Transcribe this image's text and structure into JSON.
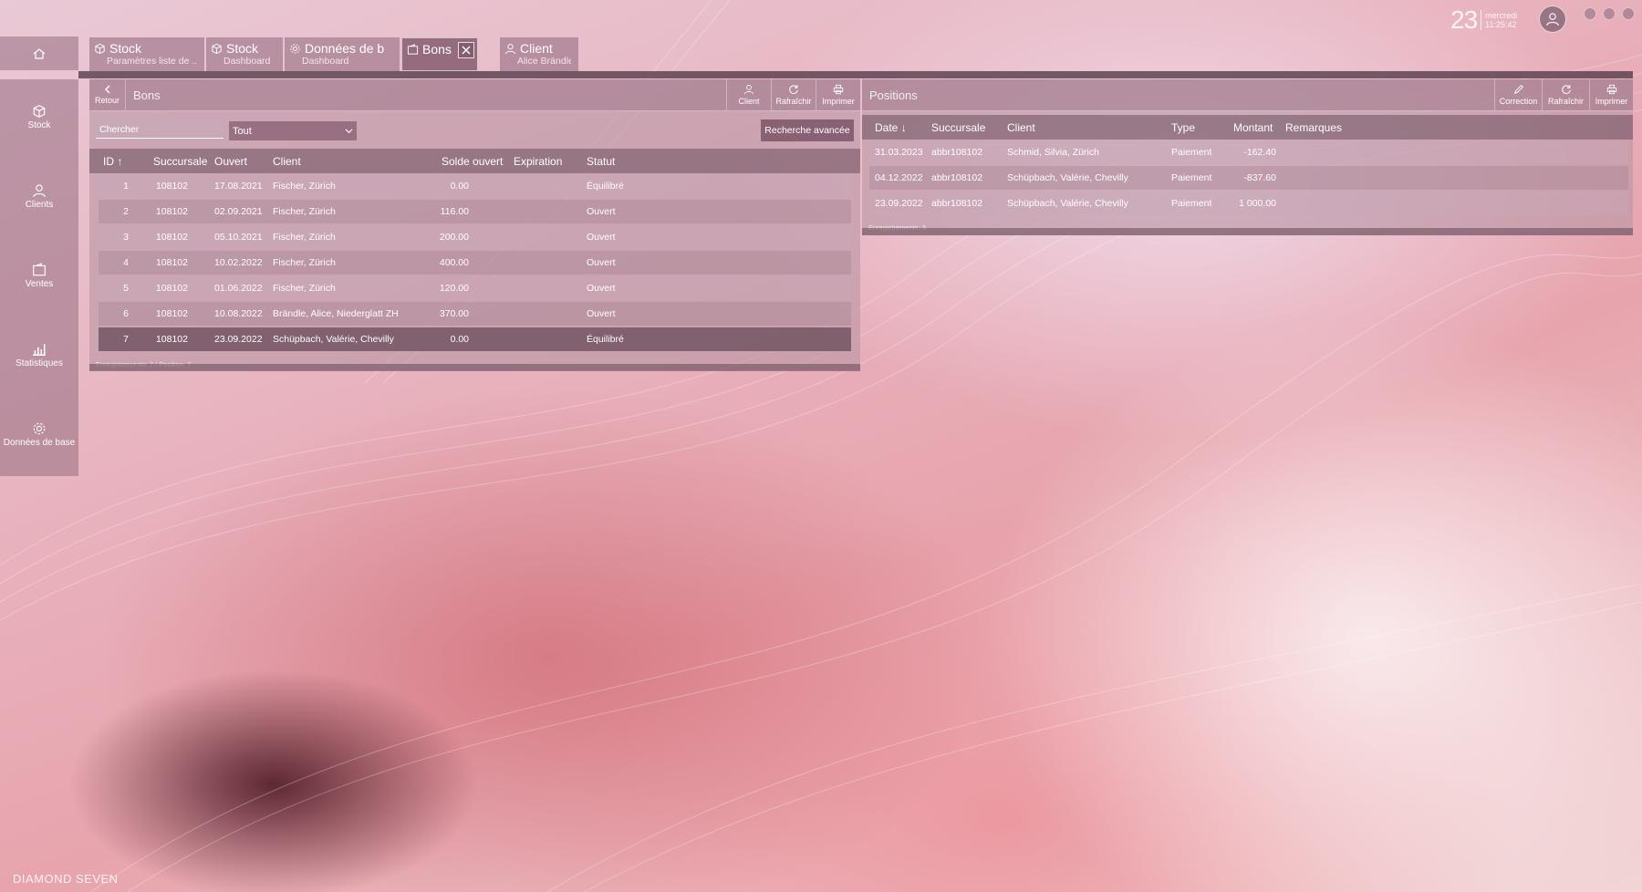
{
  "header": {
    "tabs": [
      {
        "icon": "box-icon",
        "title": "Stock",
        "subtitle": "Paramètres liste de ..."
      },
      {
        "icon": "box-icon",
        "title": "Stock",
        "subtitle": "Dashboard"
      },
      {
        "icon": "gear-icon",
        "title": "Données de b",
        "subtitle": "Dashboard"
      },
      {
        "icon": "wallet-icon",
        "title": "Bons",
        "subtitle": ""
      },
      {
        "icon": "user-icon",
        "title": "Client",
        "subtitle": "Alice Brändle"
      }
    ],
    "clock": {
      "day": "23",
      "weekday": "mercredi",
      "time": "11:25:42"
    }
  },
  "sidebar": {
    "items": [
      {
        "label": "Stock",
        "icon": "box-icon"
      },
      {
        "label": "Clients",
        "icon": "user-icon"
      },
      {
        "label": "Ventes",
        "icon": "wallet-icon"
      },
      {
        "label": "Statistiques",
        "icon": "bar-chart-icon"
      },
      {
        "label": "Données de base",
        "icon": "gear-icon"
      }
    ]
  },
  "left_panel": {
    "title": "Bons",
    "back_label": "Retour",
    "toolbar": {
      "client": "Client",
      "refresh": "Rafraîchir",
      "print": "Imprimer"
    },
    "search_placeholder": "Chercher",
    "filter_value": "Tout",
    "advanced_search": "Recherche avancée",
    "columns": {
      "id": "ID",
      "branch": "Succursale",
      "opened": "Ouvert",
      "client": "Client",
      "balance": "Solde ouvert",
      "expiration": "Expiration",
      "status": "Statut"
    },
    "rows": [
      {
        "id": "1",
        "branch": "108102",
        "opened": "17.08.2021",
        "client": "Fischer, Zürich",
        "balance": "0.00",
        "expiration": "",
        "status": "Équilibré"
      },
      {
        "id": "2",
        "branch": "108102",
        "opened": "02.09.2021",
        "client": "Fischer, Zürich",
        "balance": "116.00",
        "expiration": "",
        "status": "Ouvert"
      },
      {
        "id": "3",
        "branch": "108102",
        "opened": "05.10.2021",
        "client": "Fischer, Zürich",
        "balance": "200.00",
        "expiration": "",
        "status": "Ouvert"
      },
      {
        "id": "4",
        "branch": "108102",
        "opened": "10.02.2022",
        "client": "Fischer, Zürich",
        "balance": "400.00",
        "expiration": "",
        "status": "Ouvert"
      },
      {
        "id": "5",
        "branch": "108102",
        "opened": "01.06.2022",
        "client": "Fischer, Zürich",
        "balance": "120.00",
        "expiration": "",
        "status": "Ouvert"
      },
      {
        "id": "6",
        "branch": "108102",
        "opened": "10.08.2022",
        "client": "Brändle, Alice, Niederglatt ZH",
        "balance": "370.00",
        "expiration": "",
        "status": "Ouvert"
      },
      {
        "id": "7",
        "branch": "108102",
        "opened": "23.09.2022",
        "client": "Schüpbach, Valérie, Chevilly",
        "balance": "0.00",
        "expiration": "",
        "status": "Équilibré"
      }
    ],
    "footer": "Enregistrements: 7 / Position: 7"
  },
  "right_panel": {
    "title": "Positions",
    "toolbar": {
      "correction": "Correction",
      "refresh": "Rafraîchir",
      "print": "Imprimer"
    },
    "columns": {
      "date": "Date",
      "branch": "Succursale",
      "client": "Client",
      "type": "Type",
      "amount": "Montant",
      "remarks": "Remarques"
    },
    "rows": [
      {
        "date": "31.03.2023",
        "branch": "abbr108102",
        "client": "Schmid, Silvia, Zürich",
        "type": "Paiement",
        "amount": "-162.40",
        "remarks": ""
      },
      {
        "date": "04.12.2022",
        "branch": "abbr108102",
        "client": "Schüpbach, Valérie, Chevilly",
        "type": "Paiement",
        "amount": "-837.60",
        "remarks": ""
      },
      {
        "date": "23.09.2022",
        "branch": "abbr108102",
        "client": "Schüpbach, Valérie, Chevilly",
        "type": "Paiement",
        "amount": "1 000.00",
        "remarks": ""
      }
    ],
    "footer": "Enregistrements: 3"
  },
  "brand": "DIAMOND SEVEN"
}
